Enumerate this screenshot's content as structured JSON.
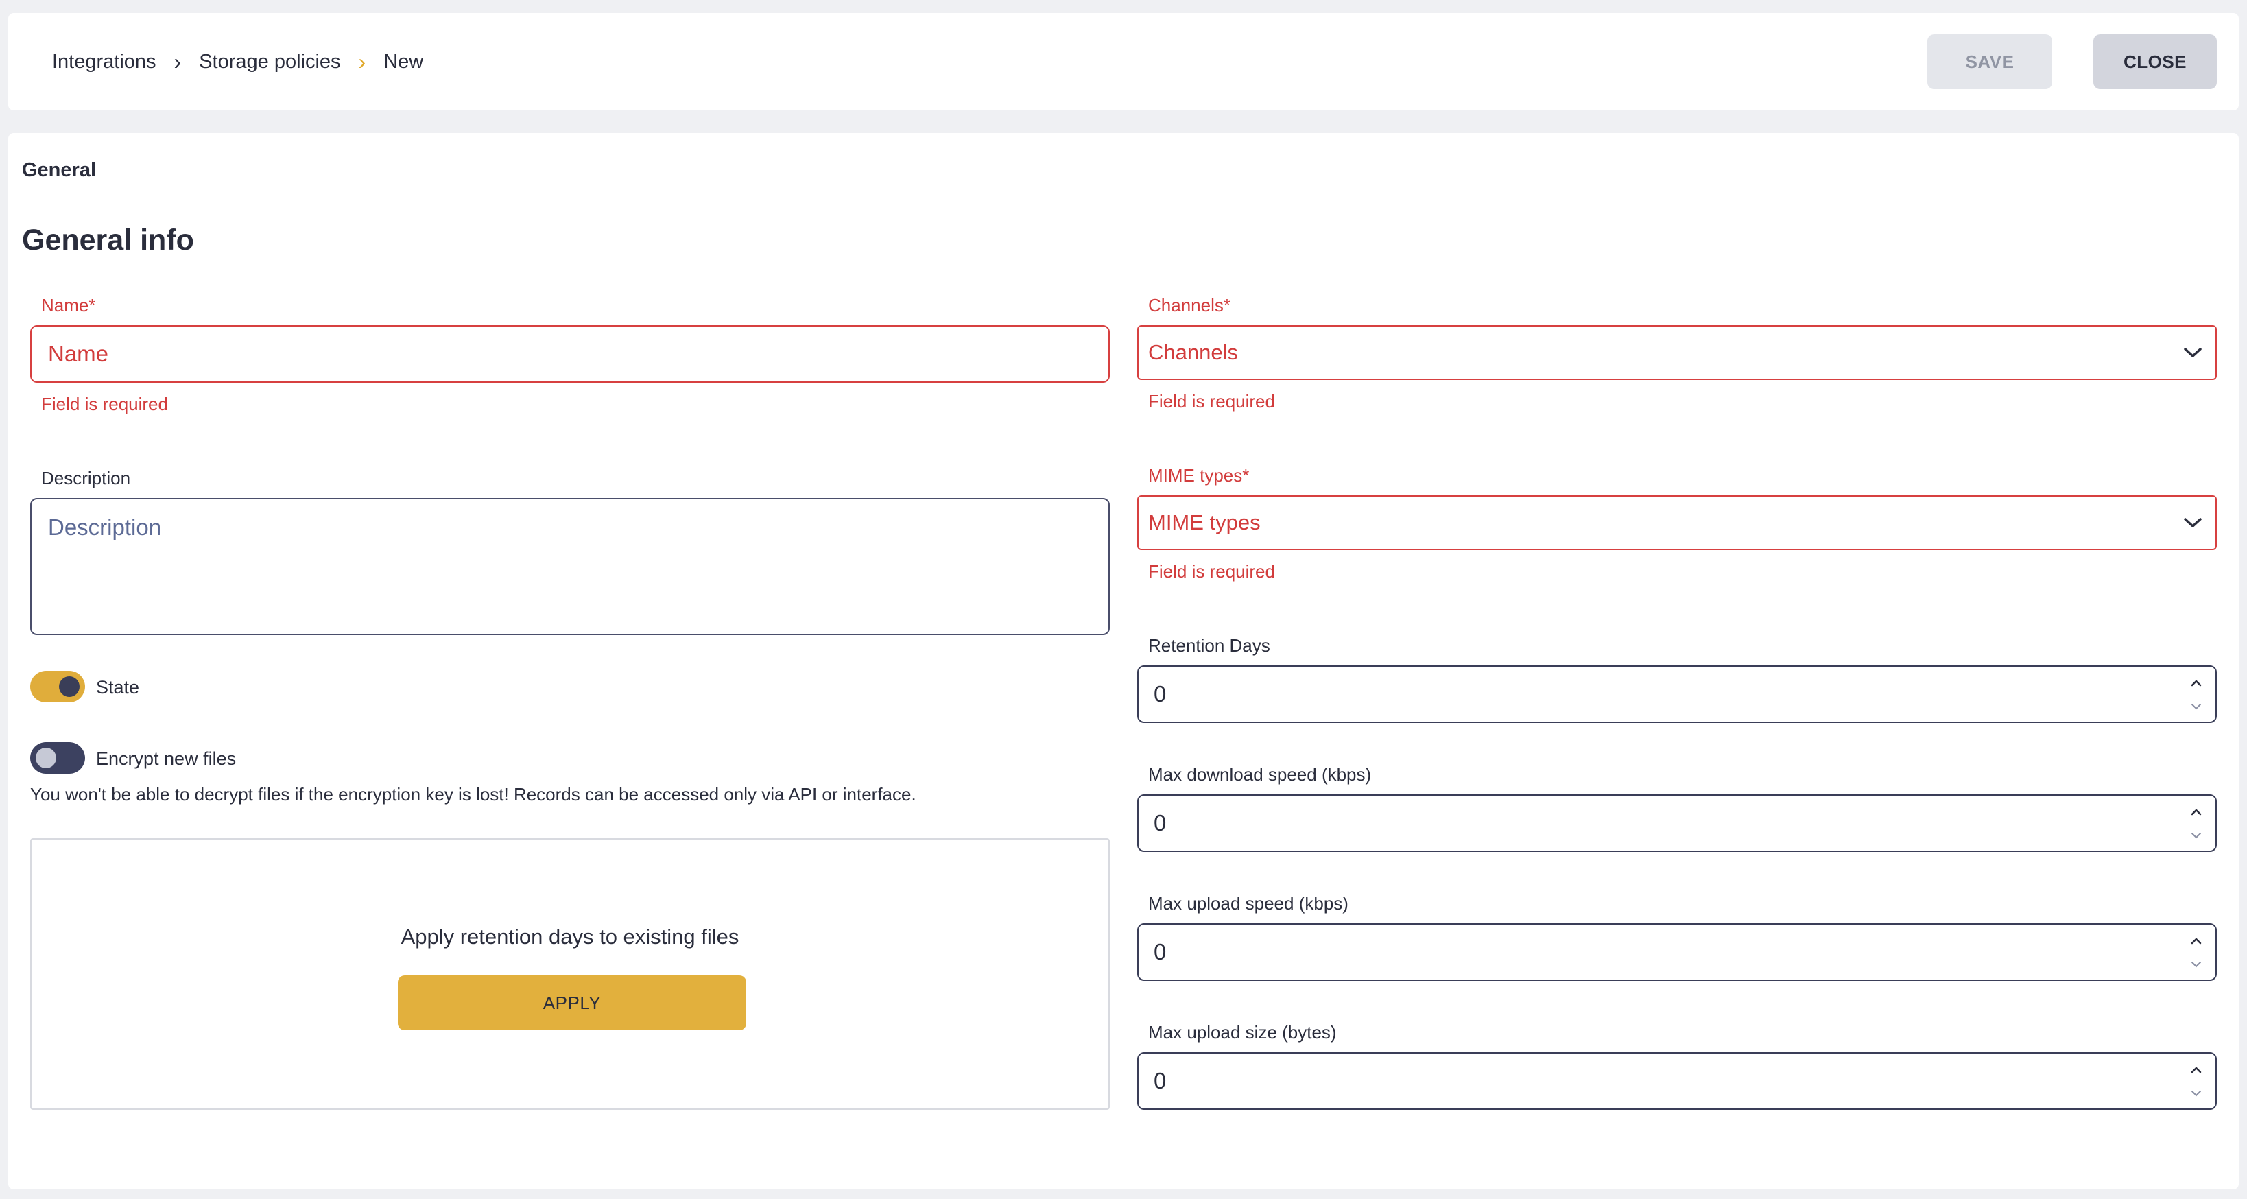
{
  "header": {
    "breadcrumb": [
      "Integrations",
      "Storage policies",
      "New"
    ],
    "save_label": "SAVE",
    "close_label": "CLOSE"
  },
  "tab": "General",
  "section_title": "General info",
  "name_field": {
    "label": "Name*",
    "placeholder": "Name",
    "error": "Field is required"
  },
  "description_field": {
    "label": "Description",
    "placeholder": "Description"
  },
  "state_toggle": {
    "label": "State",
    "on": true
  },
  "encrypt_toggle": {
    "label": "Encrypt new files",
    "on": false,
    "warning": "You won't be able to decrypt files if the encryption key is lost! Records can be accessed only via API or interface."
  },
  "apply_box": {
    "text": "Apply retention days to existing files",
    "button": "APPLY"
  },
  "channels_field": {
    "label": "Channels*",
    "placeholder": "Channels",
    "error": "Field is required"
  },
  "mime_field": {
    "label": "MIME types*",
    "placeholder": "MIME types",
    "error": "Field is required"
  },
  "retention_days": {
    "label": "Retention Days",
    "value": "0"
  },
  "max_download": {
    "label": "Max download speed (kbps)",
    "value": "0"
  },
  "max_upload_speed": {
    "label": "Max upload speed (kbps)",
    "value": "0"
  },
  "max_upload_size": {
    "label": "Max upload size (bytes)",
    "value": "0"
  },
  "colors": {
    "accent": "#e0ad3b",
    "error": "#d23c3c",
    "dark": "#3a3e58"
  }
}
